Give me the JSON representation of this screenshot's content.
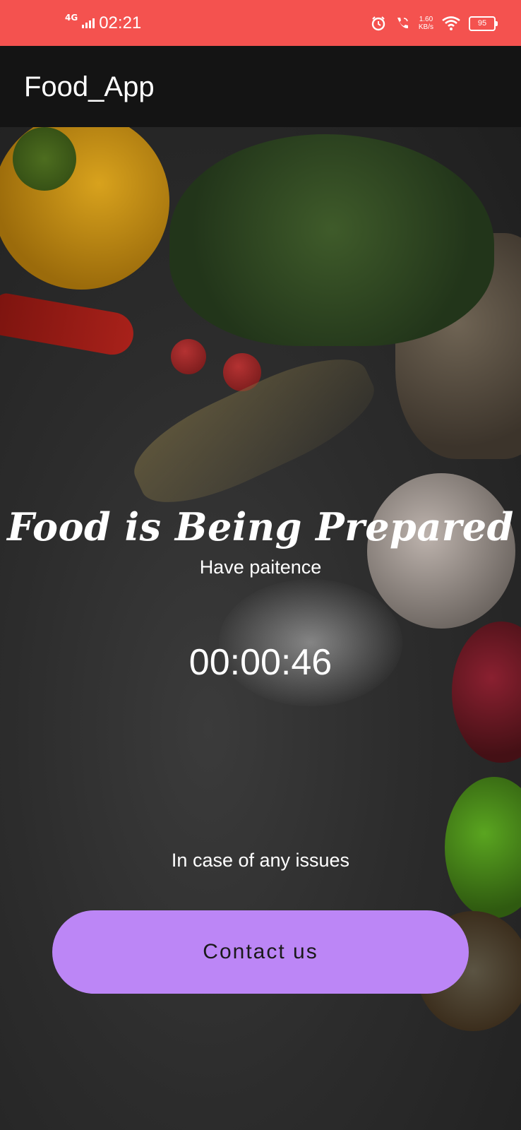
{
  "status_bar": {
    "network": "4G",
    "time": "02:21",
    "speed_value": "1.60",
    "speed_unit": "KB/s",
    "battery": "95",
    "icons": [
      "alarm-icon",
      "wifi-call-icon",
      "wifi-icon",
      "battery-icon"
    ]
  },
  "app_bar": {
    "title": "Food_App"
  },
  "main": {
    "headline": "Food is Being Prepared",
    "subline": "Have paitence",
    "timer": "00:00:46",
    "issues_text": "In case of any issues",
    "contact_button": "Contact us"
  },
  "colors": {
    "status_bar": "#f4524f",
    "app_bar": "#141414",
    "button": "#bc86f6"
  }
}
